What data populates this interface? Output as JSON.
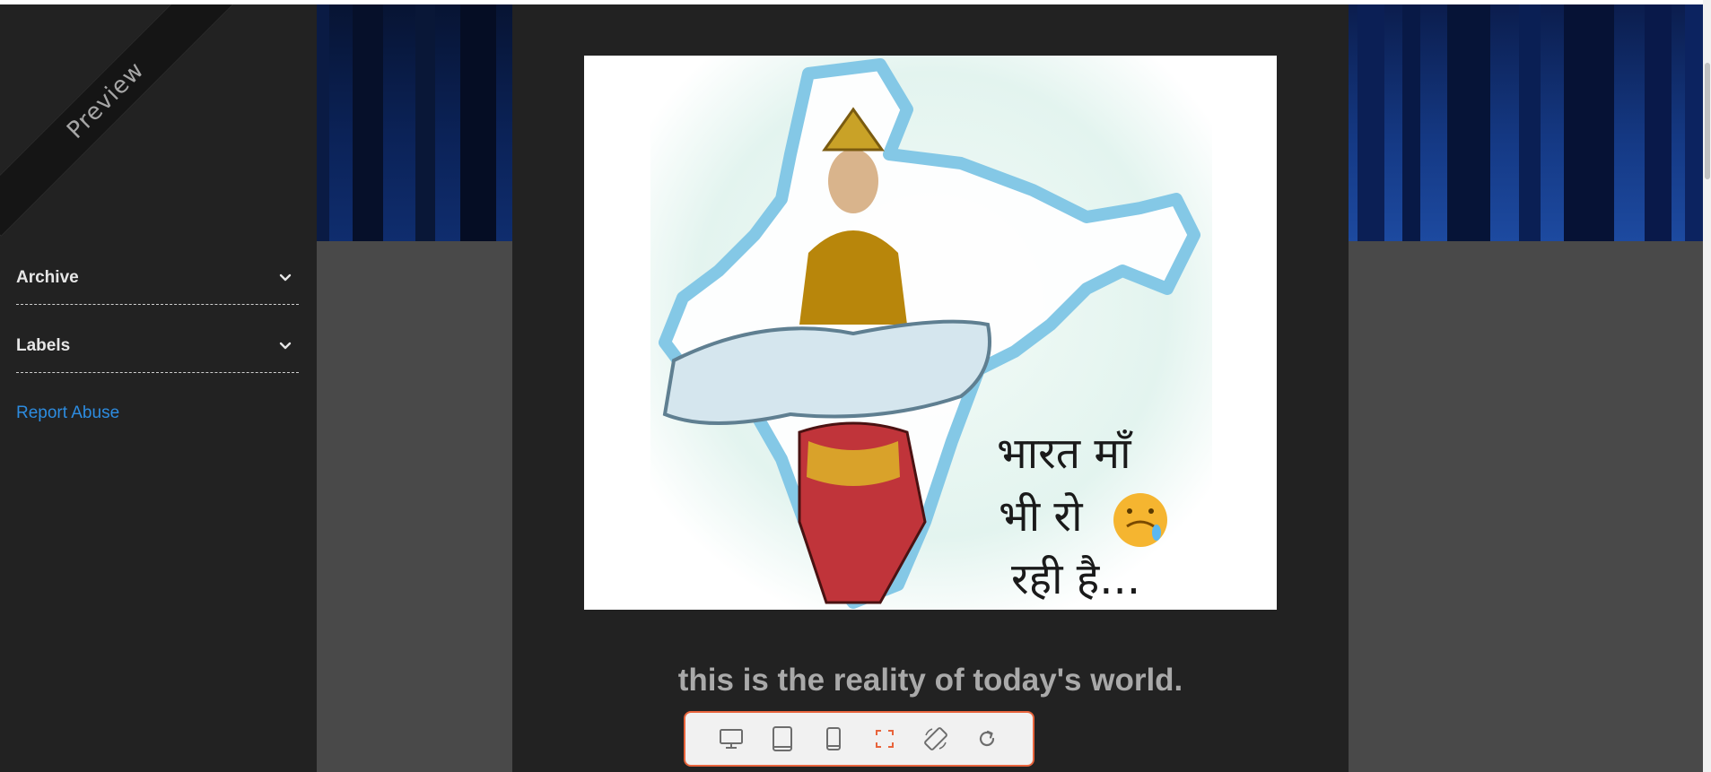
{
  "sidebar": {
    "ribbon_label": "Preview",
    "widgets": [
      {
        "label": "Archive"
      },
      {
        "label": "Labels"
      }
    ],
    "report_link": "Report Abuse"
  },
  "post": {
    "image_text": {
      "line1": "भारत माँ",
      "line2": "भी रो",
      "line3": "रही है...",
      "emoji": "😢"
    },
    "caption": "this is the reality of today's world."
  },
  "toolbar": {
    "buttons": [
      {
        "icon": "desktop-icon",
        "active": false
      },
      {
        "icon": "tablet-icon",
        "active": false
      },
      {
        "icon": "mobile-icon",
        "active": false
      },
      {
        "icon": "fullscreen-icon",
        "active": true
      },
      {
        "icon": "rotate-icon",
        "active": false
      },
      {
        "icon": "refresh-icon",
        "active": false
      }
    ],
    "accent_color": "#e8643c"
  },
  "colors": {
    "sidebar_bg": "#222222",
    "post_bg": "#222222",
    "page_bg": "#494949",
    "link": "#2d8ce0"
  }
}
